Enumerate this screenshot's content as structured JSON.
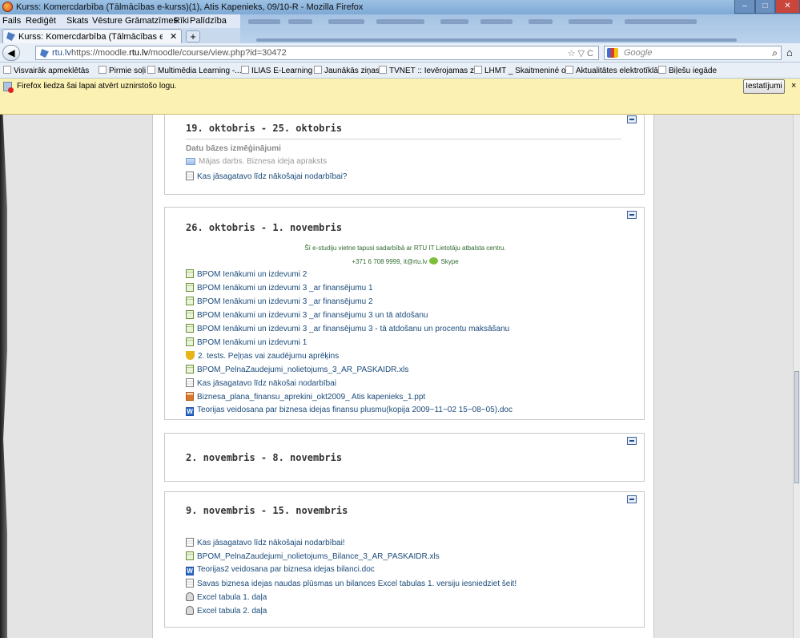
{
  "window": {
    "title": "Kurss: Komercdarbība (Tālmācības e-kurss)(1), Atis Kapenieks, 09/10-R - Mozilla Firefox"
  },
  "menu": [
    "Fails",
    "Rediģēt",
    "Skats",
    "Vēsture",
    "Grāmatzīmes",
    "Rīki",
    "Palīdzība"
  ],
  "tab": {
    "label": "Kurss: Komercdarbība (Tālmācības e-kur...",
    "new_tab": "+"
  },
  "nav": {
    "site": "rtu.lv",
    "url_prefix": "https://moodle.",
    "url_domain": "rtu.lv",
    "url_path": "/moodle/course/view.php?id=30472",
    "url_tools": "☆ ▽ C",
    "search_placeholder": "Google"
  },
  "bookmarks": [
    "Visvairāk apmeklētās",
    "Pirmie soļi",
    "Multimēdia Learning -...",
    "ILIAS E-Learning",
    "Jaunākās ziņas",
    "TVNET :: Ievērojamas z...",
    "LHMT _ Skaitmeniné o...",
    "Aktualitātes elektrotīklā",
    "Biļešu iegāde"
  ],
  "notification": {
    "message": "Firefox liedza šai lapai atvērt uznirstošo logu.",
    "button": "Iestatījumi",
    "close": "×"
  },
  "sections": [
    {
      "heading": "19. oktobris - 25. oktobris",
      "subheading": "Datu bāzes izmēģinājumi",
      "items": [
        {
          "icon": "folder",
          "text": "Mājas darbs. Biznesa ideja apraksts",
          "dim": true
        },
        {
          "icon": "page",
          "text": "Kas jāsagatavo līdz nākošajai nodarbībai?",
          "dim": false
        }
      ]
    },
    {
      "heading": "26. oktobris - 1. novembris",
      "note_line1": "Šī e-studiju vietne tapusi sadarbībā ar RTU IT Lietotāju atbalsta centru.",
      "note_line2": "+371 6 708 9999, it@rtu.lv",
      "note_skype": "Skype",
      "items": [
        {
          "icon": "sheet",
          "text": "BPOM Ienākumi un izdevumi 2"
        },
        {
          "icon": "sheet",
          "text": "BPOM Ienākumi un izdevumi 3 _ar finansējumu 1"
        },
        {
          "icon": "sheet",
          "text": "BPOM Ienākumi un izdevumi 3 _ar finansējumu 2"
        },
        {
          "icon": "sheet",
          "text": "BPOM Ienākumi un izdevumi 3 _ar finansējumu 3 un tā atdošanu"
        },
        {
          "icon": "sheet",
          "text": "BPOM Ienākumi un izdevumi 3 _ar finansējumu 3 - tā atdošanu un procentu maksāšanu"
        },
        {
          "icon": "sheet",
          "text": "BPOM Ienākumi un izdevumi 1"
        },
        {
          "icon": "quiz",
          "text": "2. tests. Peļņas vai zaudējumu aprēķins"
        },
        {
          "icon": "sheet",
          "text": "BPOM_PelnaZaudejumi_nolietojums_3_AR_PASKAIDR.xls"
        },
        {
          "icon": "page",
          "text": "Kas jāsagatavo līdz nākošai nodarbībai"
        },
        {
          "icon": "ppt",
          "text": "Biznesa_plana_finansu_aprekini_okt2009_ Atis kapenieks_1.ppt"
        },
        {
          "icon": "word",
          "text": "Teorijas veidosana par biznesa idejas finansu plusmu(kopija 2009~11~02 15~08~05).doc"
        }
      ]
    },
    {
      "heading": "2. novembris - 8. novembris",
      "items": []
    },
    {
      "heading": "9. novembris - 15. novembris",
      "items": [
        {
          "icon": "page",
          "text": "Kas jāsagatavo līdz nākošajai nodarbībai!"
        },
        {
          "icon": "sheet",
          "text": "BPOM_PelnaZaudejumi_nolietojums_Bilance_3_AR_PASKAIDR.xls"
        },
        {
          "icon": "word",
          "text": "Teorijas2 veidosana par biznesa idejas bilanci.doc"
        },
        {
          "icon": "page",
          "text": "Savas biznesa idejas naudas plūsmas un bilances Excel tabulas 1. versiju iesniedziet šeit!"
        },
        {
          "icon": "excel",
          "text": "Excel tabula 1. daļa"
        },
        {
          "icon": "excel",
          "text": "Excel tabula 2. daļa"
        }
      ]
    }
  ]
}
